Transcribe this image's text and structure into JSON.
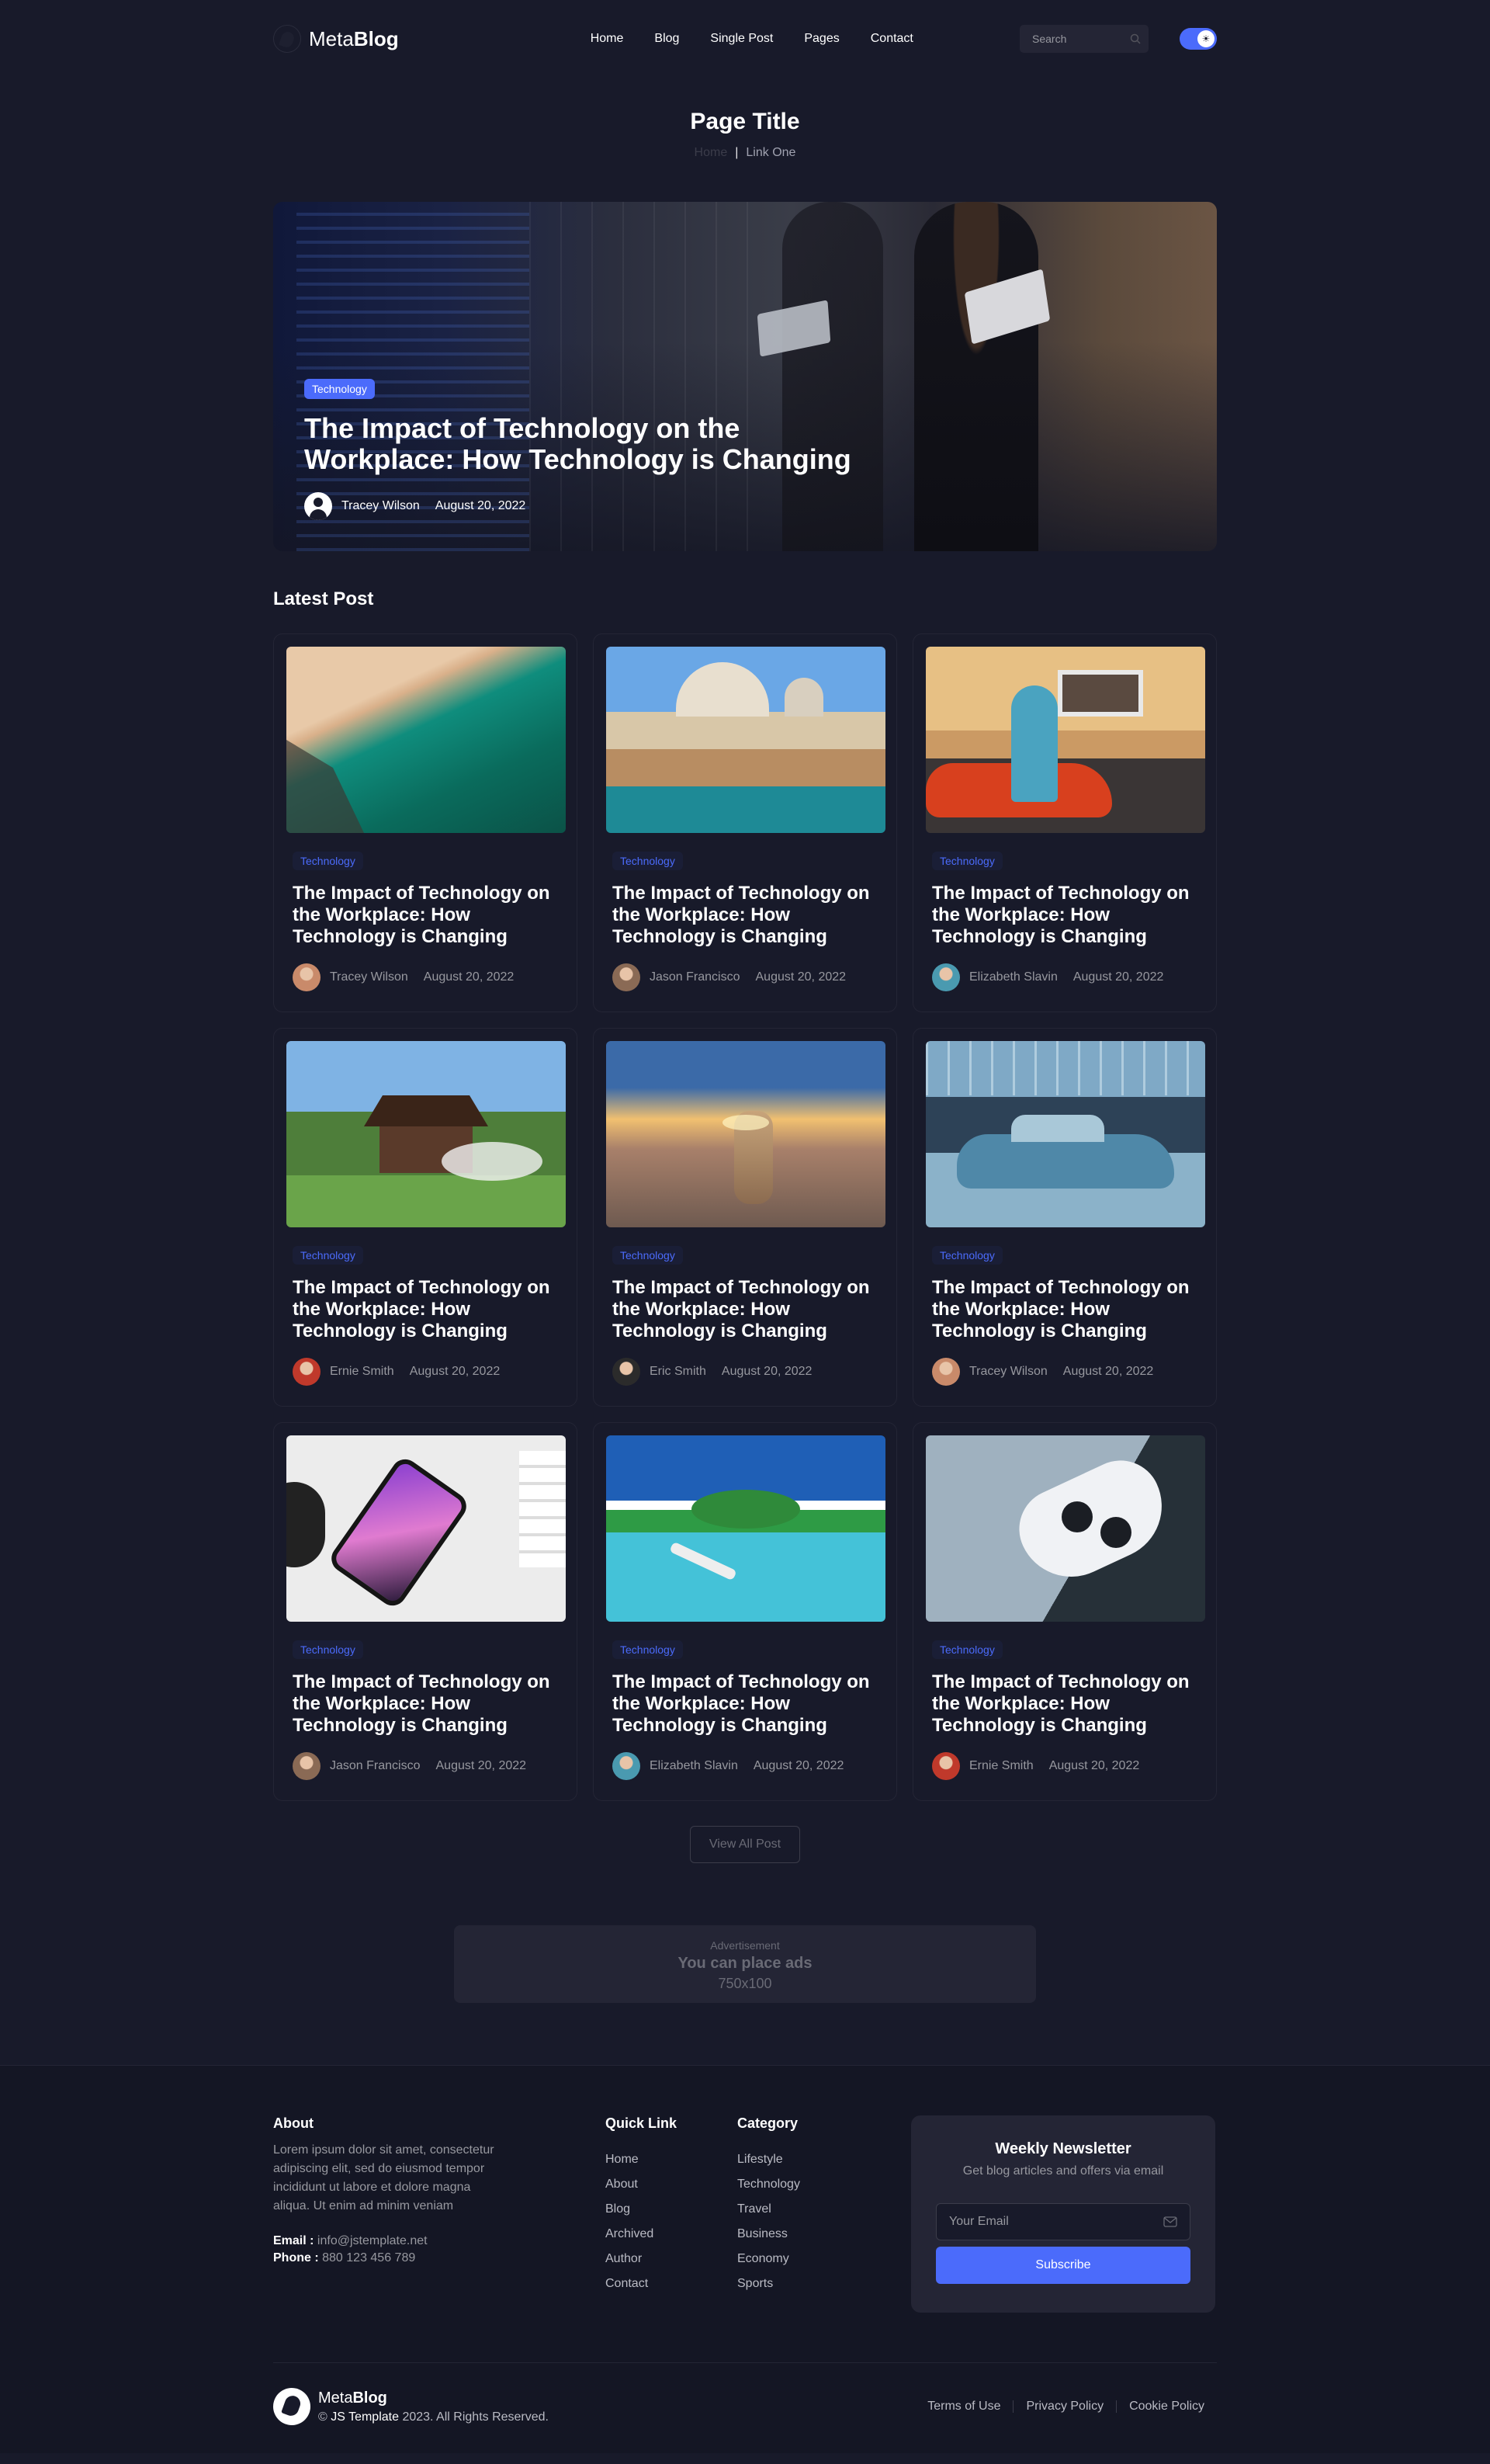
{
  "header": {
    "logo_light": "Meta",
    "logo_bold": "Blog",
    "nav": [
      "Home",
      "Blog",
      "Single Post",
      "Pages",
      "Contact"
    ],
    "search_placeholder": "Search"
  },
  "page": {
    "title": "Page Title",
    "breadcrumb_home": "Home",
    "breadcrumb_sep": "|",
    "breadcrumb_current": "Link One"
  },
  "hero": {
    "tag": "Technology",
    "title": "The Impact of Technology on the Workplace: How Technology is Changing",
    "author": "Tracey Wilson",
    "date": "August 20, 2022"
  },
  "latest": {
    "heading": "Latest Post",
    "posts": [
      {
        "tag": "Technology",
        "title": "The Impact of Technology on the Workplace: How Technology is Changing",
        "author": "Tracey Wilson",
        "date": "August 20, 2022",
        "image": "beach-aerial",
        "avatar_color": "#c98a6a"
      },
      {
        "tag": "Technology",
        "title": "The Impact of Technology on the Workplace: How Technology is Changing",
        "author": "Jason Francisco",
        "date": "August 20, 2022",
        "image": "venice-canal",
        "avatar_color": "#8a6a55"
      },
      {
        "tag": "Technology",
        "title": "The Impact of Technology on the Workplace: How Technology is Changing",
        "author": "Elizabeth Slavin",
        "date": "August 20, 2022",
        "image": "woman-red-car",
        "avatar_color": "#4a9ab0"
      },
      {
        "tag": "Technology",
        "title": "The Impact of Technology on the Workplace: How Technology is Changing",
        "author": "Ernie Smith",
        "date": "August 20, 2022",
        "image": "cottage-house",
        "avatar_color": "#c0392b"
      },
      {
        "tag": "Technology",
        "title": "The Impact of Technology on the Workplace: How Technology is Changing",
        "author": "Eric Smith",
        "date": "August 20, 2022",
        "image": "stacked-rocks-sunset",
        "avatar_color": "#2b2b2b"
      },
      {
        "tag": "Technology",
        "title": "The Impact of Technology on the Workplace: How Technology is Changing",
        "author": "Tracey Wilson",
        "date": "August 20, 2022",
        "image": "classic-blue-car",
        "avatar_color": "#c98a6a"
      },
      {
        "tag": "Technology",
        "title": "The Impact of Technology on the Workplace: How Technology is Changing",
        "author": "Jason Francisco",
        "date": "August 20, 2022",
        "image": "smartphone-desk",
        "avatar_color": "#8a6a55"
      },
      {
        "tag": "Technology",
        "title": "The Impact of Technology on the Workplace: How Technology is Changing",
        "author": "Elizabeth Slavin",
        "date": "August 20, 2022",
        "image": "tropical-island",
        "avatar_color": "#4a9ab0"
      },
      {
        "tag": "Technology",
        "title": "The Impact of Technology on the Workplace: How Technology is Changing",
        "author": "Ernie Smith",
        "date": "August 20, 2022",
        "image": "game-controller",
        "avatar_color": "#c0392b"
      }
    ],
    "view_all": "View All Post"
  },
  "ad": {
    "label": "Advertisement",
    "text": "You can place ads",
    "size": "750x100"
  },
  "footer": {
    "about_heading": "About",
    "about_text": "Lorem ipsum dolor sit amet, consectetur adipiscing elit, sed do eiusmod tempor incididunt ut labore et dolore magna aliqua. Ut enim ad minim veniam",
    "email_label": "Email :",
    "email_value": "info@jstemplate.net",
    "phone_label": "Phone :",
    "phone_value": "880 123 456 789",
    "quick_heading": "Quick Link",
    "quick_links": [
      "Home",
      "About",
      "Blog",
      "Archived",
      "Author",
      "Contact"
    ],
    "category_heading": "Category",
    "categories": [
      "Lifestyle",
      "Technology",
      "Travel",
      "Business",
      "Economy",
      "Sports"
    ],
    "newsletter_title": "Weekly Newsletter",
    "newsletter_sub": "Get blog articles and offers via email",
    "email_placeholder": "Your Email",
    "subscribe": "Subscribe",
    "brand_light": "Meta",
    "brand_bold": "Blog",
    "copy_prefix": "©",
    "copy_brand": "JS Template",
    "copy_rest": "2023. All Rights Reserved.",
    "bottom_links": [
      "Terms of Use",
      "Privacy Policy",
      "Cookie Policy"
    ]
  },
  "colors": {
    "background": "#181a2a",
    "accent": "#4b6bfb",
    "card_border": "#242535"
  }
}
